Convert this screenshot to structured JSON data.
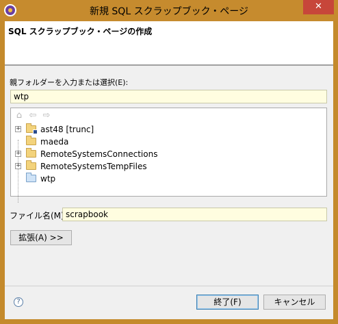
{
  "window": {
    "title": "新規 SQL スクラップブック・ページ",
    "close_label": "✕"
  },
  "banner": {
    "title": "SQL スクラップブック・ページの作成"
  },
  "parent_folder": {
    "label": "親フォルダーを入力または選択(E):",
    "value": "wtp"
  },
  "tree": {
    "toolbar_icons": [
      "home-icon",
      "back-icon",
      "forward-icon"
    ],
    "items": [
      {
        "label": "ast48 [trunc]",
        "expandable": true,
        "icon": "project-folder-icon"
      },
      {
        "label": "maeda",
        "expandable": false,
        "icon": "folder-icon"
      },
      {
        "label": "RemoteSystemsConnections",
        "expandable": true,
        "icon": "folder-icon"
      },
      {
        "label": "RemoteSystemsTempFiles",
        "expandable": true,
        "icon": "folder-icon"
      },
      {
        "label": "wtp",
        "expandable": false,
        "icon": "open-folder-icon"
      }
    ]
  },
  "file_name": {
    "label": "ファイル名(M):",
    "value": "scrapbook"
  },
  "buttons": {
    "advanced": "拡張(A) >>",
    "finish": "終了(F)",
    "cancel": "キャンセル",
    "help": "?"
  }
}
